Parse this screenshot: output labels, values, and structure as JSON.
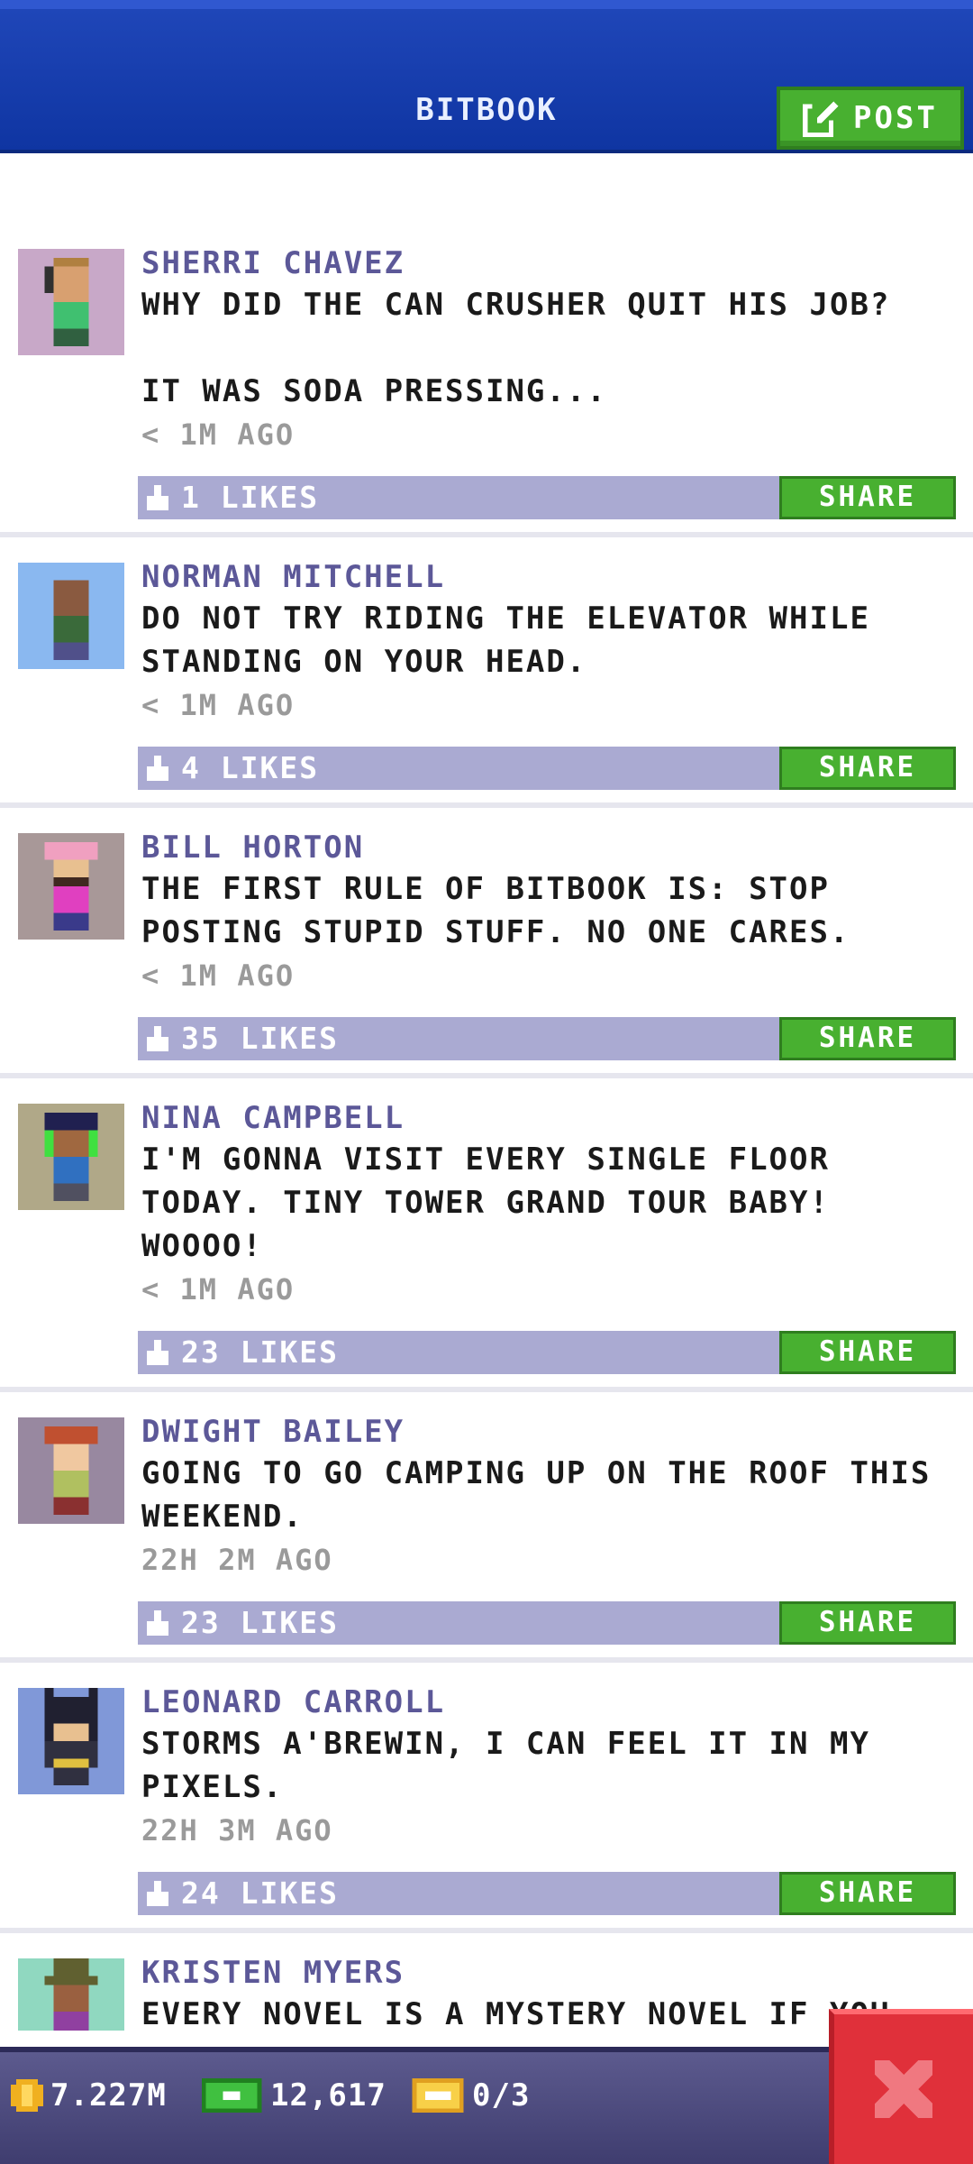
{
  "header": {
    "title": "BITBOOK",
    "post_label": "POST",
    "colors": {
      "bar": "#1f46b8",
      "button": "#48b030"
    }
  },
  "posts": [
    {
      "name": "SHERRI CHAVEZ",
      "message": "WHY DID THE CAN CRUSHER QUIT HIS JOB?\n\nIT WAS SODA PRESSING...",
      "time": "< 1M AGO",
      "likes": "1 LIKES",
      "share": "SHARE",
      "avatar_bg": "#c8a8c8"
    },
    {
      "name": "NORMAN MITCHELL",
      "message": "DO NOT TRY RIDING THE ELEVATOR WHILE STANDING ON YOUR HEAD.",
      "time": "< 1M AGO",
      "likes": "4 LIKES",
      "share": "SHARE",
      "avatar_bg": "#8ab8f0"
    },
    {
      "name": "BILL HORTON",
      "message": "THE FIRST RULE OF BITBOOK IS: STOP POSTING STUPID STUFF. NO ONE CARES.",
      "time": "< 1M AGO",
      "likes": "35 LIKES",
      "share": "SHARE",
      "avatar_bg": "#a89898"
    },
    {
      "name": "NINA CAMPBELL",
      "message": "I'M GONNA VISIT EVERY SINGLE FLOOR TODAY. TINY TOWER GRAND TOUR BABY! WOOOO!",
      "time": "< 1M AGO",
      "likes": "23 LIKES",
      "share": "SHARE",
      "avatar_bg": "#b0a888"
    },
    {
      "name": "DWIGHT BAILEY",
      "message": "GOING TO GO CAMPING UP ON THE ROOF THIS WEEKEND.",
      "time": "22H 2M AGO",
      "likes": "23 LIKES",
      "share": "SHARE",
      "avatar_bg": "#9888a0"
    },
    {
      "name": "LEONARD CARROLL",
      "message": "STORMS A'BREWIN, I CAN FEEL IT IN MY PIXELS.",
      "time": "22H 3M AGO",
      "likes": "24 LIKES",
      "share": "SHARE",
      "avatar_bg": "#8098d8"
    },
    {
      "name": "KRISTEN MYERS",
      "message": "EVERY NOVEL IS A MYSTERY NOVEL IF YOU DON'T FINISH IT.",
      "time": "",
      "likes": "",
      "share": "",
      "avatar_bg": "#90d8c0"
    }
  ],
  "bottom": {
    "coins": "7.227M",
    "bux": "12,617",
    "tickets": "0/3"
  }
}
